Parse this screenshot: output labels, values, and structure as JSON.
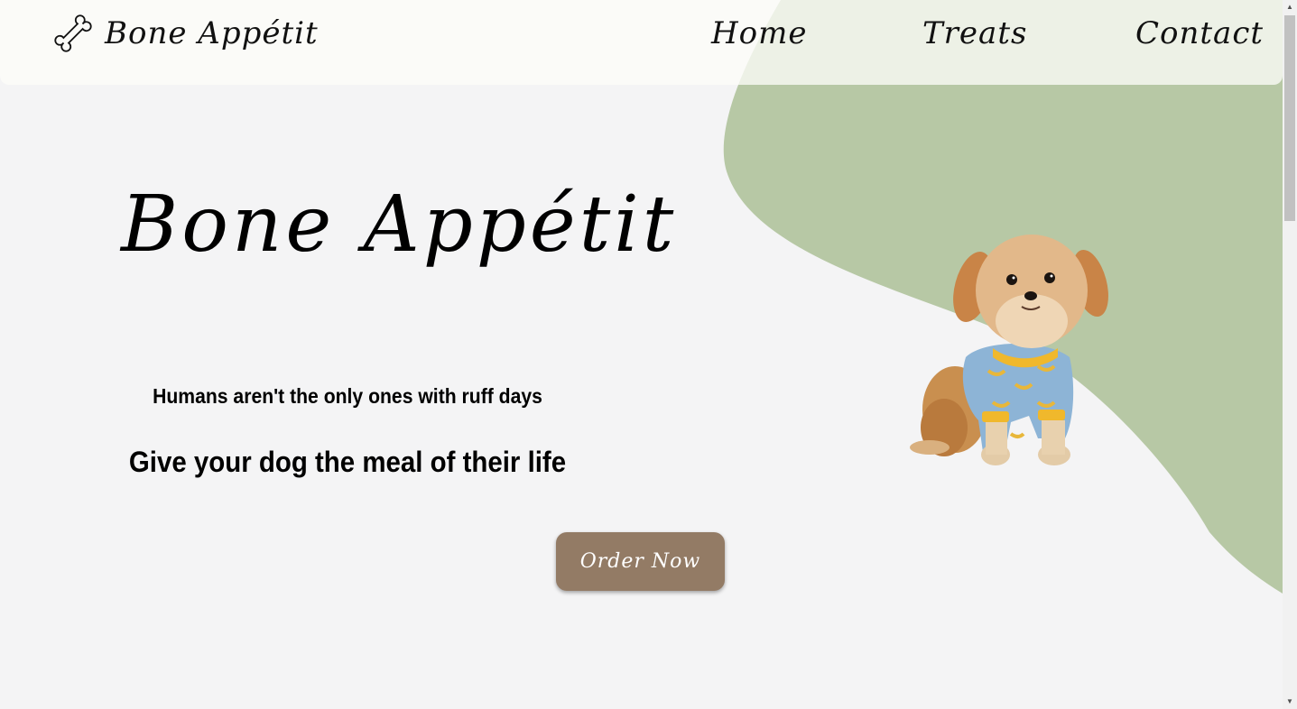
{
  "nav": {
    "logo_text": "Bone Appétit",
    "links": [
      {
        "label": "Home"
      },
      {
        "label": "Treats"
      },
      {
        "label": "Contact"
      }
    ]
  },
  "hero": {
    "title": "Bone Appétit",
    "tagline_small": "Humans aren't the only ones with ruff days",
    "tagline_big": "Give your dog the meal of their life",
    "cta_label": "Order Now"
  },
  "colors": {
    "background": "#f4f4f5",
    "navbar": "#fbfaf6",
    "blob": "#b7c8a5",
    "button": "#937b65",
    "text": "#000000"
  },
  "icons": {
    "logo": "bone-icon",
    "scroll_up": "scroll-up-arrow-icon",
    "scroll_down": "scroll-down-arrow-icon"
  }
}
